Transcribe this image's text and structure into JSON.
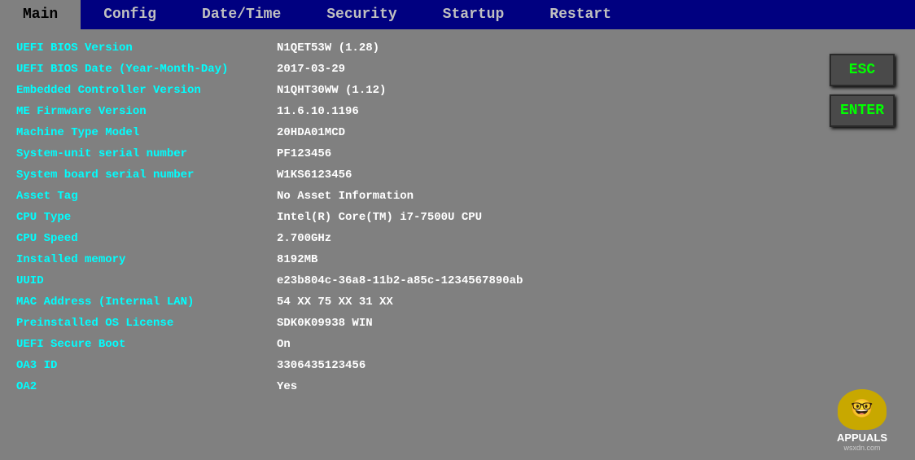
{
  "nav": {
    "items": [
      {
        "label": "Main",
        "active": true
      },
      {
        "label": "Config",
        "active": false
      },
      {
        "label": "Date/Time",
        "active": false
      },
      {
        "label": "Security",
        "active": false
      },
      {
        "label": "Startup",
        "active": false
      },
      {
        "label": "Restart",
        "active": false
      }
    ]
  },
  "buttons": {
    "esc": "ESC",
    "enter": "ENTER"
  },
  "rows": [
    {
      "label": "UEFI BIOS Version",
      "value": "N1QET53W (1.28)"
    },
    {
      "label": "UEFI BIOS Date (Year-Month-Day)",
      "value": "2017-03-29"
    },
    {
      "label": "Embedded Controller Version",
      "value": "N1QHT30WW (1.12)"
    },
    {
      "label": "ME Firmware Version",
      "value": "11.6.10.1196"
    },
    {
      "label": "Machine Type Model",
      "value": "20HDA01MCD"
    },
    {
      "label": "System-unit serial number",
      "value": "PF123456"
    },
    {
      "label": "System board serial number",
      "value": "W1KS6123456"
    },
    {
      "label": "Asset Tag",
      "value": "No Asset Information"
    },
    {
      "label": "CPU Type",
      "value": "Intel(R) Core(TM) i7-7500U CPU"
    },
    {
      "label": "CPU Speed",
      "value": "2.700GHz"
    },
    {
      "label": "Installed memory",
      "value": "8192MB"
    },
    {
      "label": "UUID",
      "value": "e23b804c-36a8-11b2-a85c-1234567890ab"
    },
    {
      "label": "MAC Address (Internal LAN)",
      "value": "54 XX 75 XX 31 XX"
    },
    {
      "label": "Preinstalled OS License",
      "value": "SDK0K09938 WIN"
    },
    {
      "label": "UEFI Secure Boot",
      "value": "On"
    },
    {
      "label": "OA3 ID",
      "value": "3306435123456"
    },
    {
      "label": "OA2",
      "value": "Yes"
    }
  ],
  "watermark": {
    "icon": "🤓",
    "brand": "APPUALS",
    "site": "wsxdn.com"
  }
}
